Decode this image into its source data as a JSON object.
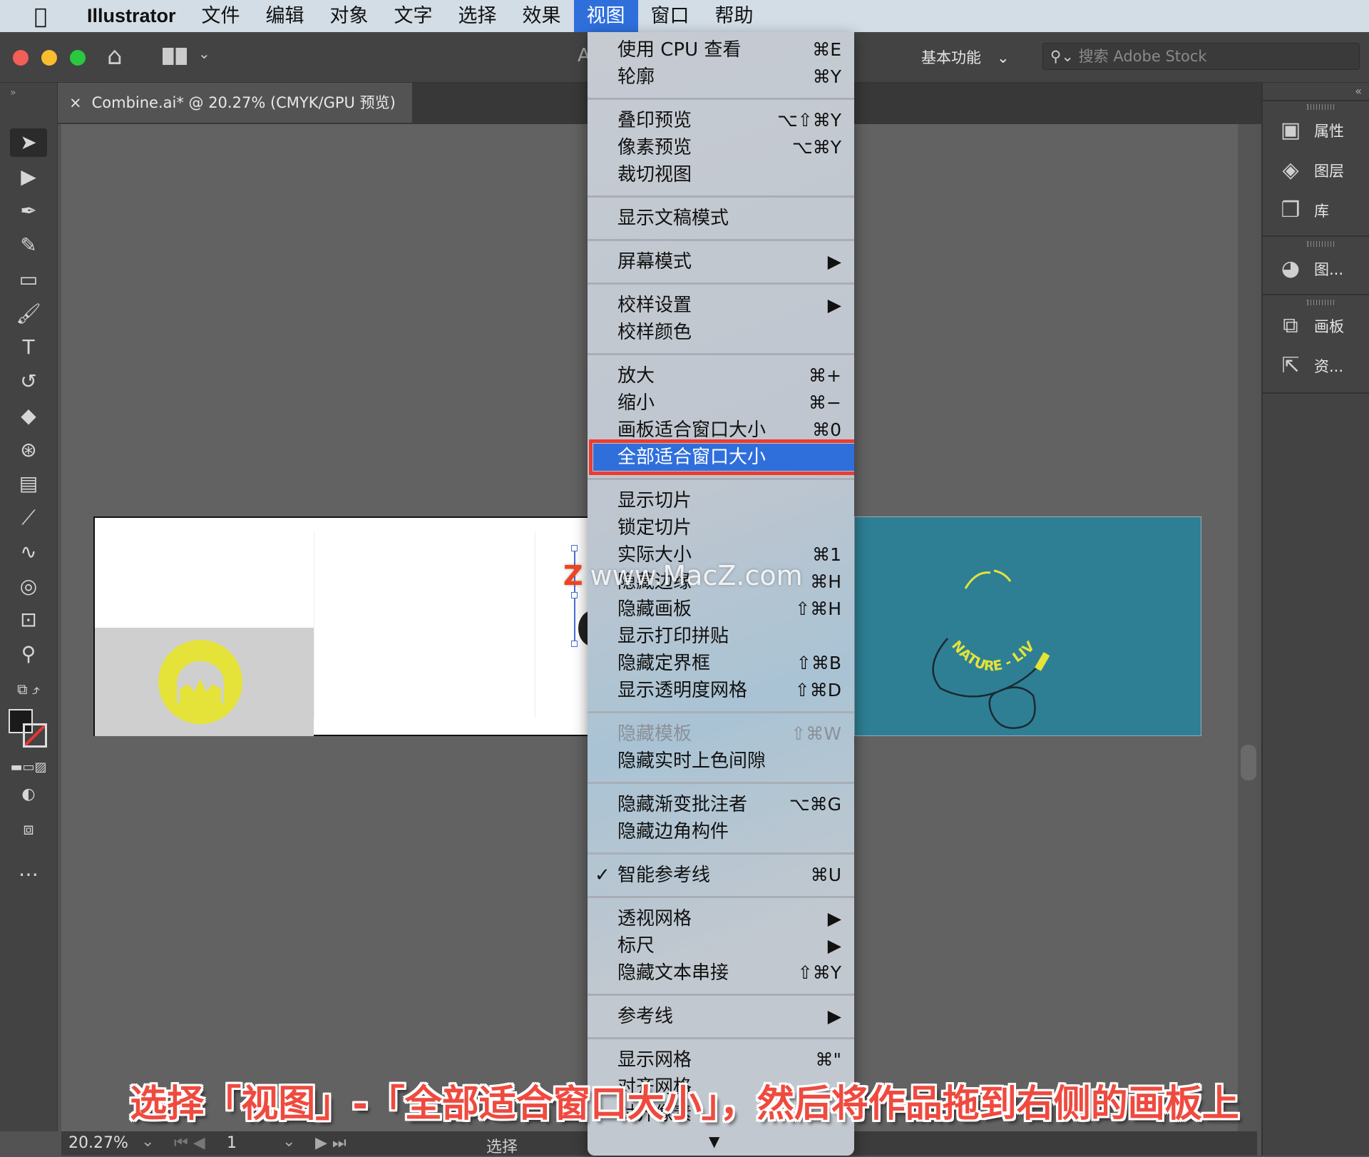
{
  "menubar": {
    "apple_icon": "apple-logo",
    "app": "Illustrator",
    "items": [
      "文件",
      "编辑",
      "对象",
      "文字",
      "选择",
      "效果",
      "视图",
      "窗口",
      "帮助"
    ],
    "active": "视图"
  },
  "toolbar": {
    "workspace": "基本功能",
    "search_placeholder": "搜索 Adobe Stock",
    "partial_label": "A"
  },
  "document_tab": {
    "close": "×",
    "title": "Combine.ai* @ 20.27% (CMYK/GPU 预览)"
  },
  "right_panel": {
    "items": [
      {
        "label": "属性",
        "icon": "properties-icon"
      },
      {
        "label": "图层",
        "icon": "layers-icon"
      },
      {
        "label": "库",
        "icon": "libraries-icon"
      },
      {
        "label": "图...",
        "icon": "image-trace-icon"
      },
      {
        "label": "画板",
        "icon": "artboards-icon"
      },
      {
        "label": "资...",
        "icon": "asset-export-icon"
      }
    ]
  },
  "view_menu": {
    "items": [
      {
        "label": "使用 CPU 查看",
        "shortcut": "⌘E"
      },
      {
        "label": "轮廓",
        "shortcut": "⌘Y"
      },
      {
        "sep": true
      },
      {
        "label": "叠印预览",
        "shortcut": "⌥⇧⌘Y"
      },
      {
        "label": "像素预览",
        "shortcut": "⌥⌘Y"
      },
      {
        "label": "裁切视图",
        "shortcut": ""
      },
      {
        "sep": true
      },
      {
        "label": "显示文稿模式",
        "shortcut": ""
      },
      {
        "sep": true
      },
      {
        "label": "屏幕模式",
        "shortcut": "▶"
      },
      {
        "sep": true
      },
      {
        "label": "校样设置",
        "shortcut": "▶"
      },
      {
        "label": "校样颜色",
        "shortcut": ""
      },
      {
        "sep": true
      },
      {
        "label": "放大",
        "shortcut": "⌘+"
      },
      {
        "label": "缩小",
        "shortcut": "⌘−"
      },
      {
        "label": "画板适合窗口大小",
        "shortcut": "⌘0"
      },
      {
        "label": "全部适合窗口大小",
        "shortcut": "",
        "highlighted": true
      },
      {
        "sep": true
      },
      {
        "label": "显示切片",
        "shortcut": ""
      },
      {
        "label": "锁定切片",
        "shortcut": ""
      },
      {
        "label": "实际大小",
        "shortcut": "⌘1"
      },
      {
        "label": "隐藏边缘",
        "shortcut": "⌘H"
      },
      {
        "label": "隐藏画板",
        "shortcut": "⇧⌘H"
      },
      {
        "label": "显示打印拼贴",
        "shortcut": ""
      },
      {
        "label": "隐藏定界框",
        "shortcut": "⇧⌘B"
      },
      {
        "label": "显示透明度网格",
        "shortcut": "⇧⌘D"
      },
      {
        "sep": true
      },
      {
        "label": "隐藏模板",
        "shortcut": "⇧⌘W",
        "disabled": true
      },
      {
        "label": "隐藏实时上色间隙",
        "shortcut": ""
      },
      {
        "sep": true
      },
      {
        "label": "隐藏渐变批注者",
        "shortcut": "⌥⌘G"
      },
      {
        "label": "隐藏边角构件",
        "shortcut": ""
      },
      {
        "sep": true
      },
      {
        "label": "智能参考线",
        "shortcut": "⌘U",
        "checked": true
      },
      {
        "sep": true
      },
      {
        "label": "透视网格",
        "shortcut": "▶"
      },
      {
        "label": "标尺",
        "shortcut": "▶"
      },
      {
        "label": "隐藏文本串接",
        "shortcut": "⇧⌘Y"
      },
      {
        "sep": true
      },
      {
        "label": "参考线",
        "shortcut": "▶"
      },
      {
        "sep": true
      },
      {
        "label": "显示网格",
        "shortcut": "⌘\""
      },
      {
        "label": "对齐网格",
        "shortcut": ""
      },
      {
        "label": "对齐像素",
        "shortcut": ""
      }
    ],
    "check_mark": "✓",
    "scroll_arrow": "▼"
  },
  "artwork": {
    "logo_text": "NATURE - LIVE",
    "teal": "#2e7f94",
    "yellow": "#e5e33a"
  },
  "watermark": {
    "z": "Z",
    "text": "www.MacZ.com"
  },
  "status_bar": {
    "zoom": "20.27%",
    "artboard": "1",
    "tool": "选择"
  },
  "caption": "选择「视图」-「全部适合窗口大小」，然后将作品拖到右侧的画板上"
}
